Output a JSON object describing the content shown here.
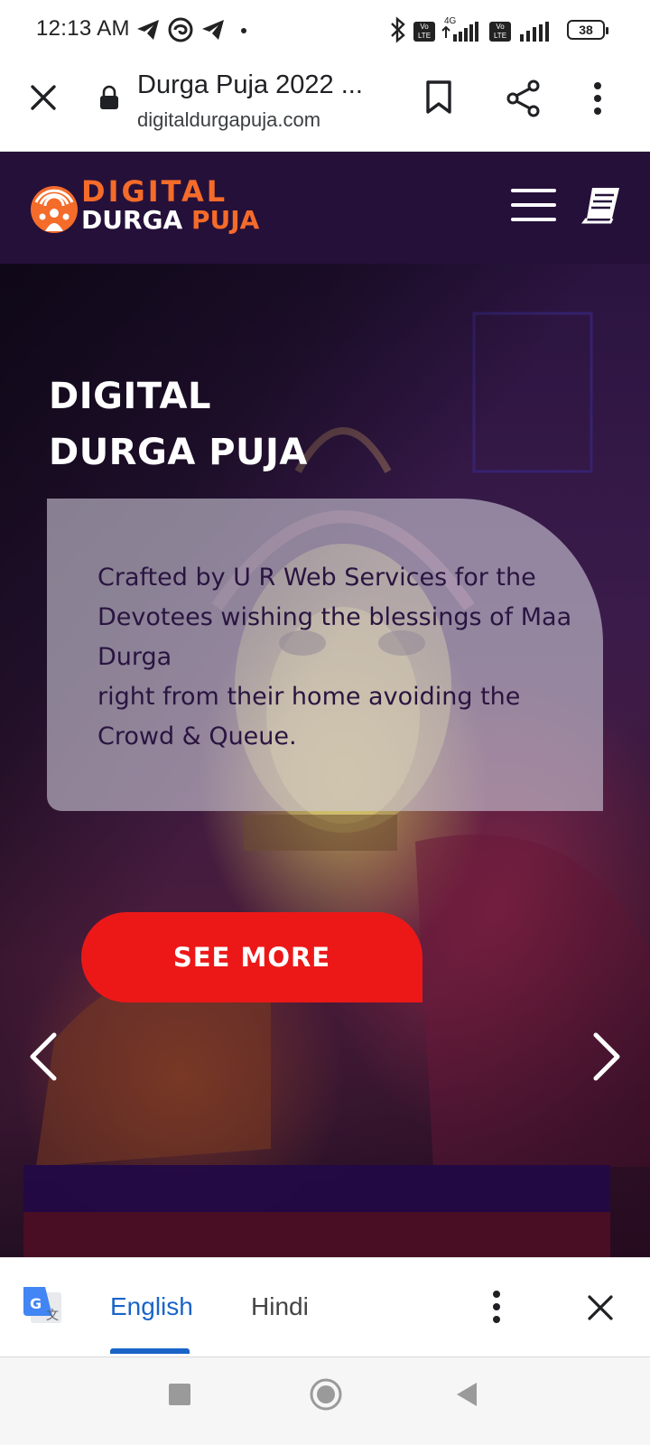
{
  "status_bar": {
    "time": "12:13 AM",
    "battery": "38",
    "network_label": "4G",
    "volte_label": "Vo LTE",
    "icons": [
      "telegram-icon",
      "threads-icon",
      "telegram-icon",
      "dot-icon",
      "bluetooth-icon",
      "volte-icon",
      "signal-icon",
      "signal-icon",
      "battery-icon"
    ]
  },
  "browser": {
    "tab_title": "Durga Puja 2022 ...",
    "url": "digitaldurgapuja.com",
    "icons": [
      "close-icon",
      "lock-icon",
      "bookmark-icon",
      "share-icon",
      "more-vert-icon"
    ]
  },
  "site": {
    "logo_line1": "DIGITAL",
    "logo_line2_a": "DURGA",
    "logo_line2_b": "PUJA",
    "logo_colors": {
      "accent": "#f46b2a",
      "light": "#ffffff"
    },
    "hero_title": [
      "DIGITAL",
      "DURGA PUJA"
    ],
    "hero_description": [
      "Crafted by U R Web Services for the",
      "Devotees wishing the blessings of Maa",
      "Durga",
      "right from their home avoiding the",
      "Crowd & Queue."
    ],
    "cta_label": "SEE MORE",
    "cta_color": "#ec1818",
    "header_icons": [
      "menu-icon",
      "book-icon"
    ],
    "slider_icons": [
      "chevron-left-icon",
      "chevron-right-icon"
    ]
  },
  "translate_bar": {
    "languages": [
      "English",
      "Hindi"
    ],
    "selected": "English",
    "accent": "#1a64c8",
    "icons": [
      "google-translate-icon",
      "more-vert-icon",
      "close-icon"
    ]
  },
  "nav_bar": {
    "icons": [
      "recents-square-icon",
      "home-circle-icon",
      "back-triangle-icon"
    ]
  }
}
